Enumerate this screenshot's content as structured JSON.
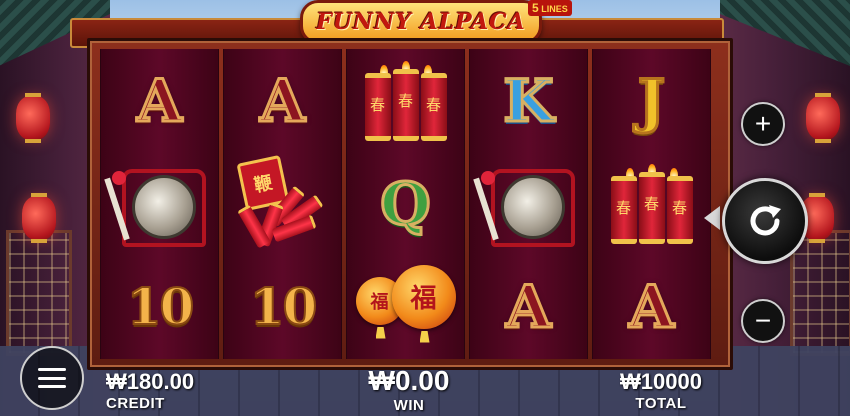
{
  "game": {
    "title": "FUNNY ALPACA",
    "lines_number": "5",
    "lines_label": "LINES"
  },
  "reels": [
    [
      "A",
      "gong",
      "10"
    ],
    [
      "A",
      "firework",
      "10"
    ],
    [
      "firecrackers",
      "Q",
      "fu-lanterns"
    ],
    [
      "K",
      "gong",
      "A"
    ],
    [
      "J",
      "firecrackers",
      "A"
    ]
  ],
  "symbol_text": {
    "chun": "春",
    "fu": "福",
    "firework_box": "鞭"
  },
  "controls": {
    "plus": "+",
    "minus": "−",
    "spin_icon": "refresh-icon",
    "menu_icon": "hamburger-icon"
  },
  "hud": {
    "credit_value": "₩180.00",
    "credit_label": "CREDIT",
    "win_value": "₩0.00",
    "win_label": "WIN",
    "total_value": "₩10000",
    "total_label": "TOTAL"
  },
  "colors": {
    "reel_bg": "#5d0828",
    "frame": "#8d2f1c",
    "gold": "#e4a85b"
  }
}
